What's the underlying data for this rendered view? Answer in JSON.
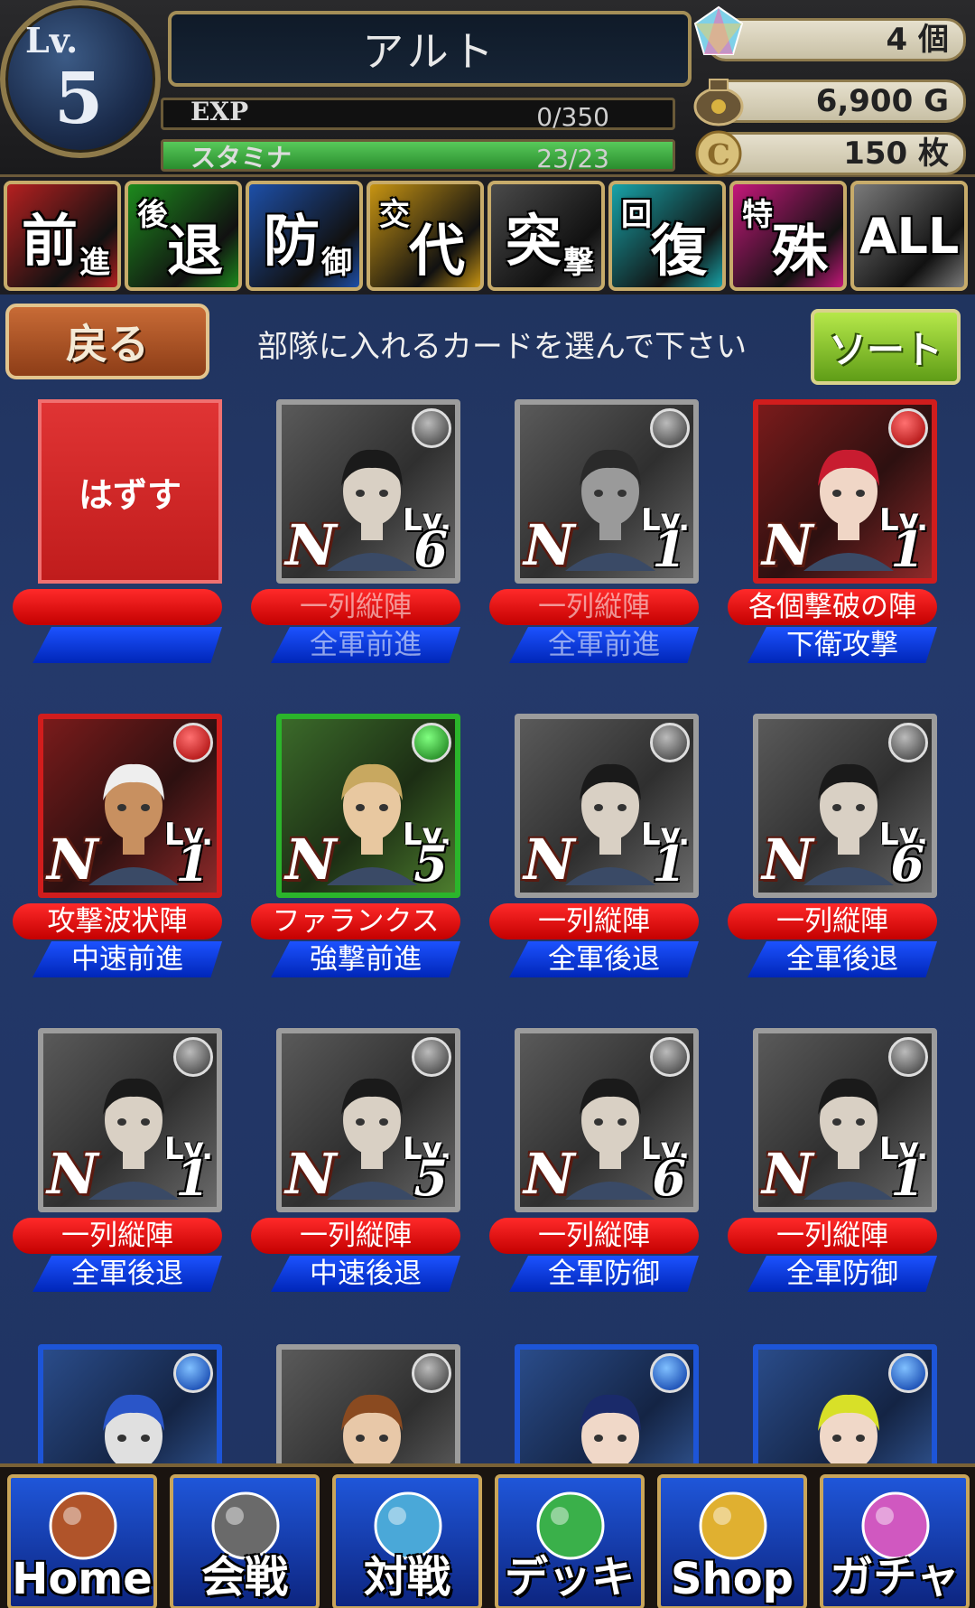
{
  "header": {
    "level_label": "Lv.",
    "level": "5",
    "player_name": "アルト",
    "exp_label": "EXP",
    "exp_value": "0/350",
    "exp_fraction": 0,
    "stamina_label": "スタミナ",
    "stamina_value": "23/23",
    "stamina_fraction": 1,
    "gems": "4 個",
    "gold": "6,900 G",
    "coins": "150 枚"
  },
  "tabs": [
    {
      "big": "前",
      "small": "進",
      "color": "#b52020"
    },
    {
      "big": "退",
      "small": "後",
      "color": "#1d8a1d"
    },
    {
      "big": "防",
      "small": "御",
      "color": "#1d4fa8"
    },
    {
      "big": "代",
      "small": "交",
      "color": "#c79412"
    },
    {
      "big": "突",
      "small": "撃",
      "color": "#4a4a4a"
    },
    {
      "big": "復",
      "small": "回",
      "color": "#18a3a8"
    },
    {
      "big": "殊",
      "small": "特",
      "color": "#c4187a"
    },
    {
      "big": "ALL",
      "small": "",
      "color": "#7a7a7a"
    }
  ],
  "actions": {
    "back": "戻る",
    "prompt": "部隊に入れるカードを選んで下さい",
    "sort": "ソート",
    "remove": "はずす"
  },
  "cards": [
    {
      "type": "remove",
      "formation": "",
      "tactic": ""
    },
    {
      "type": "card",
      "color": "gray",
      "rarity": "N",
      "lv_label": "Lv.",
      "level": "6",
      "formation": "一列縦陣",
      "tactic": "全軍前進",
      "dim": true,
      "hair": "#1a1a1a",
      "skin": "#d9d0c4"
    },
    {
      "type": "card",
      "color": "gray",
      "rarity": "N",
      "lv_label": "Lv.",
      "level": "1",
      "formation": "一列縦陣",
      "tactic": "全軍前進",
      "dim": true,
      "hair": "#2a2a2a",
      "skin": "#9a9a9a"
    },
    {
      "type": "card",
      "color": "red",
      "rarity": "N",
      "lv_label": "Lv.",
      "level": "1",
      "formation": "各個撃破の陣",
      "tactic": "下衛攻撃",
      "dim": false,
      "hair": "#c81c30",
      "skin": "#f0d6c6"
    },
    {
      "type": "card",
      "color": "red",
      "rarity": "N",
      "lv_label": "Lv.",
      "level": "1",
      "formation": "攻撃波状陣",
      "tactic": "中速前進",
      "dim": false,
      "hair": "#eeeeee",
      "skin": "#c89060"
    },
    {
      "type": "card",
      "color": "green",
      "rarity": "N",
      "lv_label": "Lv.",
      "level": "5",
      "formation": "ファランクス",
      "tactic": "強撃前進",
      "dim": false,
      "hair": "#c8a860",
      "skin": "#e8c8a0"
    },
    {
      "type": "card",
      "color": "gray",
      "rarity": "N",
      "lv_label": "Lv.",
      "level": "1",
      "formation": "一列縦陣",
      "tactic": "全軍後退",
      "dim": false,
      "hair": "#1a1a1a",
      "skin": "#d9d0c4"
    },
    {
      "type": "card",
      "color": "gray",
      "rarity": "N",
      "lv_label": "Lv.",
      "level": "6",
      "formation": "一列縦陣",
      "tactic": "全軍後退",
      "dim": false,
      "hair": "#1a1a1a",
      "skin": "#d9d0c4"
    },
    {
      "type": "card",
      "color": "gray",
      "rarity": "N",
      "lv_label": "Lv.",
      "level": "1",
      "formation": "一列縦陣",
      "tactic": "全軍後退",
      "dim": false,
      "hair": "#1a1a1a",
      "skin": "#d9d0c4"
    },
    {
      "type": "card",
      "color": "gray",
      "rarity": "N",
      "lv_label": "Lv.",
      "level": "5",
      "formation": "一列縦陣",
      "tactic": "中速後退",
      "dim": false,
      "hair": "#1a1a1a",
      "skin": "#d9d0c4"
    },
    {
      "type": "card",
      "color": "gray",
      "rarity": "N",
      "lv_label": "Lv.",
      "level": "6",
      "formation": "一列縦陣",
      "tactic": "全軍防御",
      "dim": false,
      "hair": "#1a1a1a",
      "skin": "#d9d0c4"
    },
    {
      "type": "card",
      "color": "gray",
      "rarity": "N",
      "lv_label": "Lv.",
      "level": "1",
      "formation": "一列縦陣",
      "tactic": "全軍防御",
      "dim": false,
      "hair": "#1a1a1a",
      "skin": "#d9d0c4"
    },
    {
      "type": "card",
      "color": "blue",
      "rarity": "",
      "lv_label": "",
      "level": "",
      "formation": "",
      "tactic": "",
      "dim": false,
      "hair": "#2a55c8",
      "skin": "#e0e0e0"
    },
    {
      "type": "card",
      "color": "gray",
      "rarity": "",
      "lv_label": "",
      "level": "",
      "formation": "",
      "tactic": "",
      "dim": false,
      "hair": "#8a4a20",
      "skin": "#e8c8a8"
    },
    {
      "type": "card",
      "color": "blue",
      "rarity": "",
      "lv_label": "",
      "level": "",
      "formation": "",
      "tactic": "",
      "dim": false,
      "hair": "#1a2a6a",
      "skin": "#f0d8c8"
    },
    {
      "type": "card",
      "color": "blue",
      "rarity": "",
      "lv_label": "",
      "level": "",
      "formation": "",
      "tactic": "",
      "dim": false,
      "hair": "#d8e028",
      "skin": "#f0d8c8"
    }
  ],
  "nav": [
    {
      "label": "Home",
      "icon": "house-icon"
    },
    {
      "label": "会戦",
      "icon": "battle-party-icon"
    },
    {
      "label": "対戦",
      "icon": "crossed-swords-icon"
    },
    {
      "label": "デッキ",
      "icon": "orbs-icon"
    },
    {
      "label": "Shop",
      "icon": "coins-icon"
    },
    {
      "label": "ガチャ",
      "icon": "gem-icon"
    }
  ]
}
